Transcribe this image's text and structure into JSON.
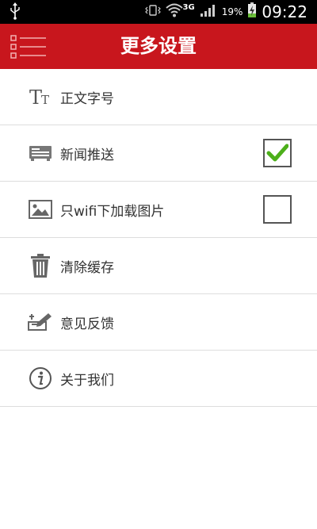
{
  "status_bar": {
    "battery": "19%",
    "network": "3G",
    "time": "09:22",
    "icons": [
      "usb-icon",
      "vibrate-icon",
      "wifi-icon",
      "signal-icon",
      "battery-charging-icon"
    ]
  },
  "app_bar": {
    "title": "更多设置",
    "menu_icon": "list-menu-icon",
    "background": "#c8161d"
  },
  "settings": [
    {
      "label": "正文字号",
      "icon": "font-size-icon",
      "checkbox": null
    },
    {
      "label": "新闻推送",
      "icon": "news-push-icon",
      "checkbox": true
    },
    {
      "label": "只wifi下加载图片",
      "icon": "image-icon",
      "checkbox": false
    },
    {
      "label": "清除缓存",
      "icon": "trash-icon",
      "checkbox": null
    },
    {
      "label": "意见反馈",
      "icon": "feedback-icon",
      "checkbox": null
    },
    {
      "label": "关于我们",
      "icon": "info-icon",
      "checkbox": null
    }
  ],
  "colors": {
    "accent": "#c8161d",
    "check": "#4caf1a",
    "text": "#333333",
    "divider": "#dddddd"
  }
}
